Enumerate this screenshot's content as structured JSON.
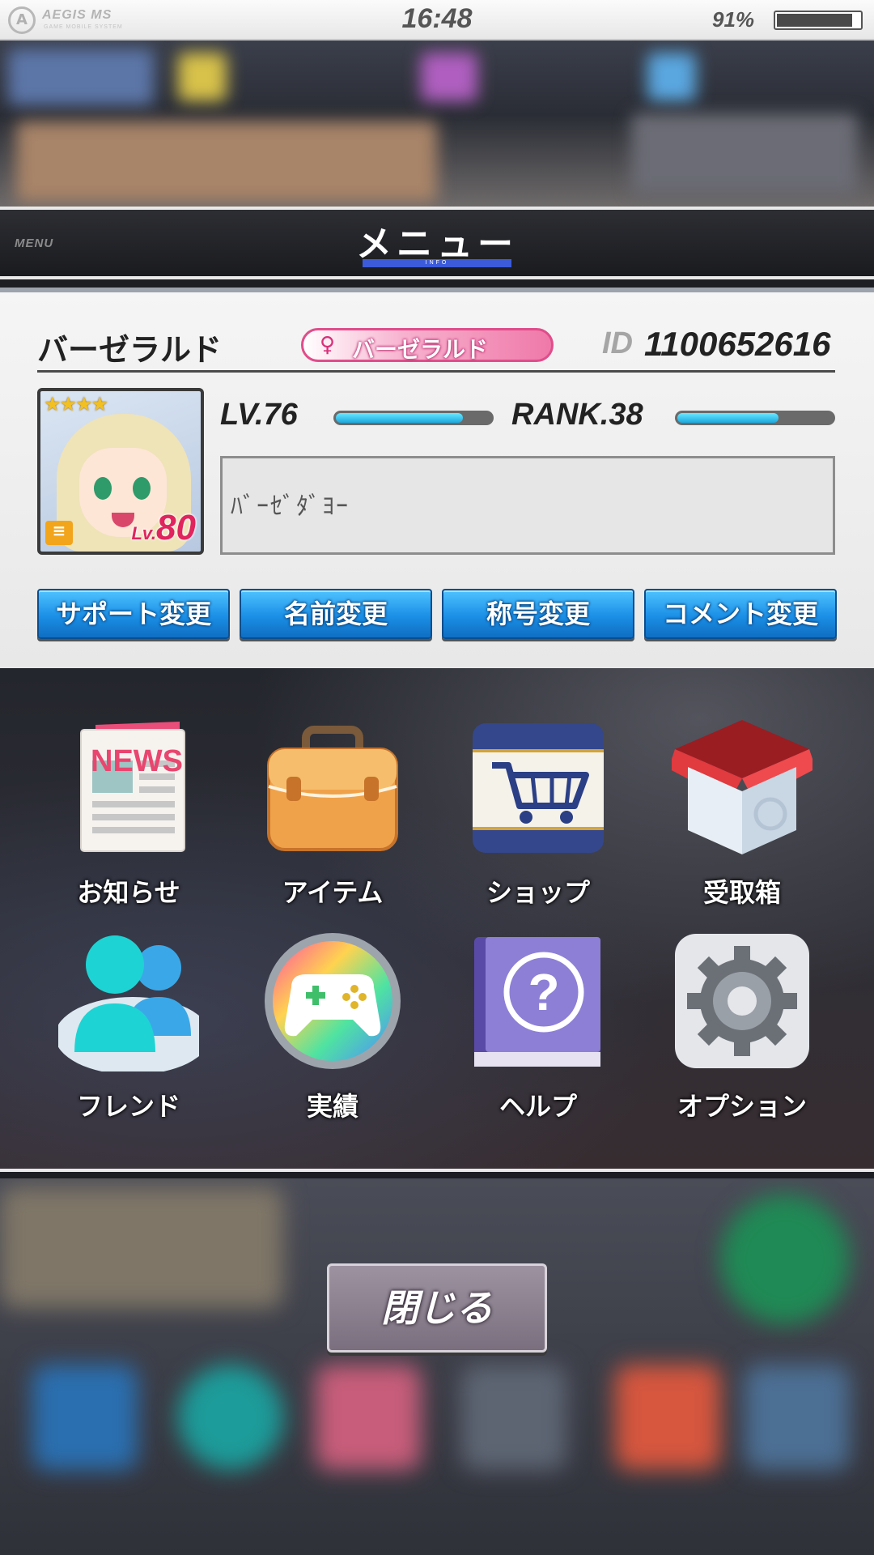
{
  "status_bar": {
    "brand": "AEGIS MS",
    "brand_sub": "GAME MOBILE SYSTEM",
    "time": "16:48",
    "battery_text": "91%",
    "battery_level": 0.91
  },
  "header": {
    "label_en": "MENU",
    "title": "メニュー",
    "title_sub": "INFO"
  },
  "profile": {
    "name": "バーゼラルド",
    "title_badge": "バーゼラルド",
    "id_label": "ID",
    "id_value": "1100652616",
    "avatar": {
      "stars": "★★★★",
      "lv_prefix": "Lv.",
      "lv_value": "80"
    },
    "level_label": "LV.76",
    "level_progress": 0.82,
    "rank_label": "RANK.38",
    "rank_progress": 0.65,
    "comment": "ﾊﾞｰｾﾞﾀﾞﾖｰ"
  },
  "actions": {
    "support": "サポート変更",
    "name": "名前変更",
    "title": "称号変更",
    "comment": "コメント変更"
  },
  "menu": {
    "news": "お知らせ",
    "item": "アイテム",
    "shop": "ショップ",
    "inbox": "受取箱",
    "friend": "フレンド",
    "achievement": "実績",
    "help": "ヘルプ",
    "option": "オプション",
    "news_icon_text": "NEWS"
  },
  "close_label": "閉じる",
  "colors": {
    "accent_blue": "#1b8fe6",
    "title_pink": "#e04d8a",
    "progress_cyan": "#1aa9df"
  }
}
